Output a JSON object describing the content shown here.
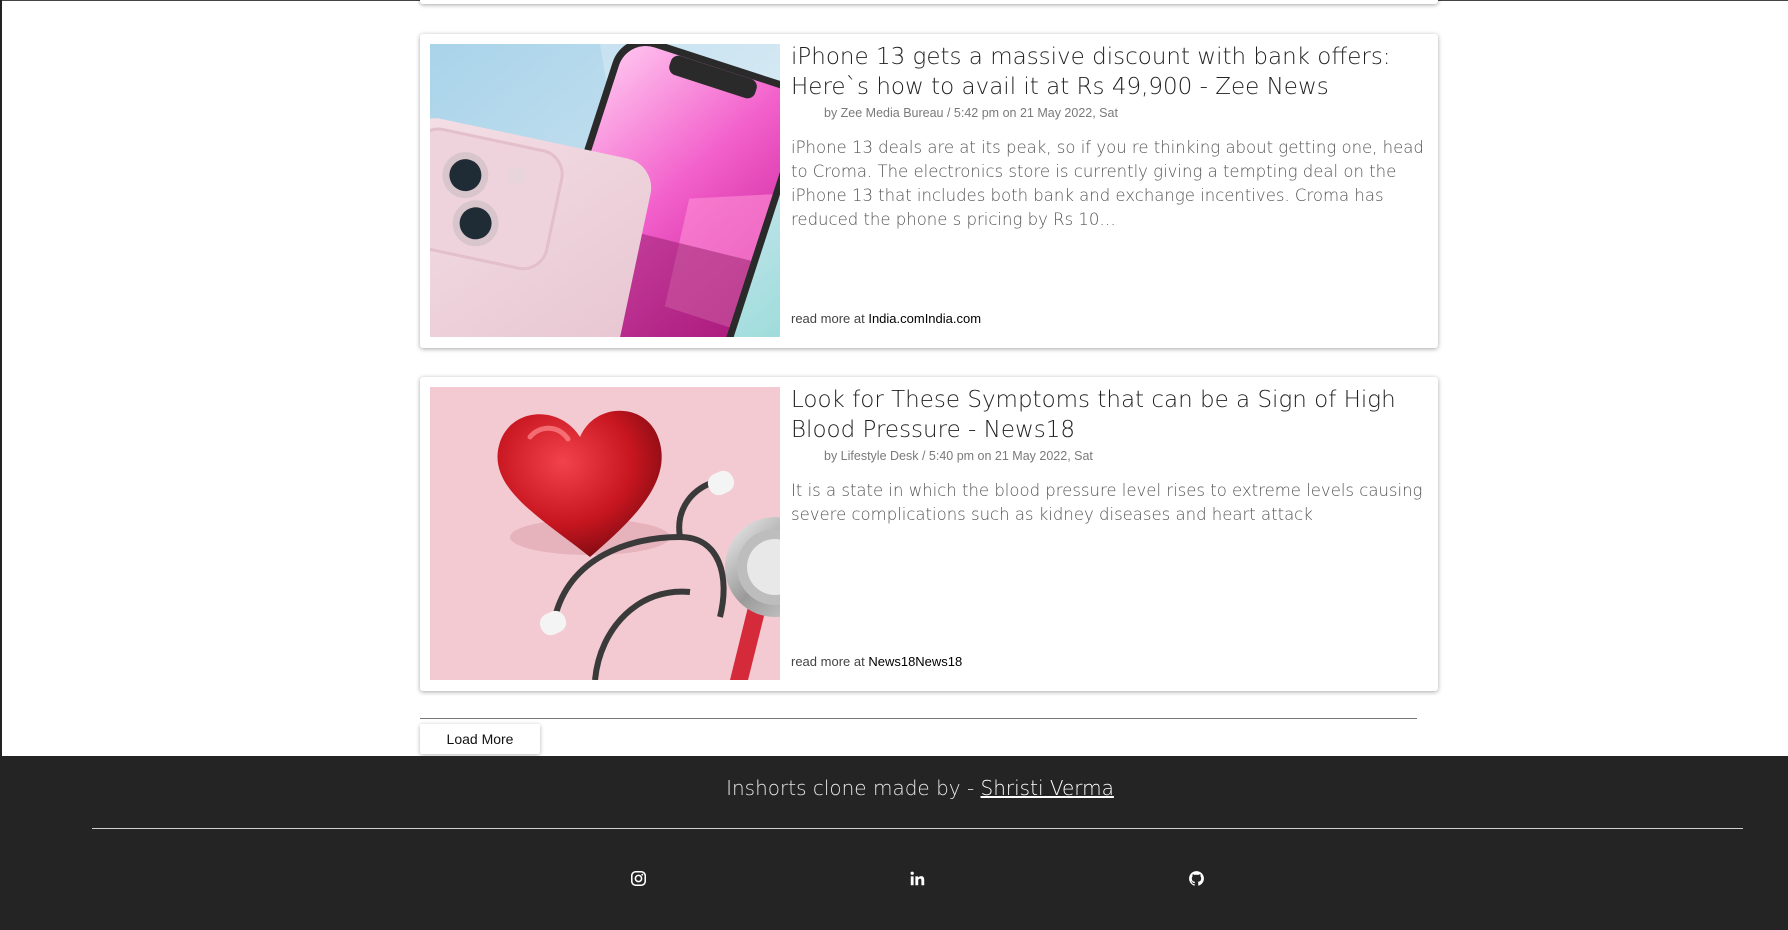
{
  "articles": [
    {
      "title": "iPhone 13 gets a massive discount with bank offers: Here`s how to avail it at Rs 49,900 - Zee News",
      "meta": "by Zee Media Bureau / 5:42 pm on 21 May 2022, Sat",
      "description": "iPhone 13 deals are at its peak, so if you re thinking about getting one, head to Croma. The electronics store is currently giving a tempting deal on the iPhone 13 that includes both bank and exchange incentives. Croma has reduced the phone s pricing by Rs 10…",
      "read_more_prefix": "read more at ",
      "source": "India.comIndia.com"
    },
    {
      "title": "Look for These Symptoms that can be a Sign of High Blood Pressure - News18",
      "meta": "by Lifestyle Desk / 5:40 pm on 21 May 2022, Sat",
      "description": "It is a state in which the blood pressure level rises to extreme levels causing severe complications such as kidney diseases and heart attack",
      "read_more_prefix": "read more at ",
      "source": "News18News18"
    }
  ],
  "load_more_label": "Load More",
  "footer": {
    "credit_prefix": "Inshorts clone made by - ",
    "author": "Shristi Verma",
    "social": [
      "instagram-icon",
      "linkedin-icon",
      "github-icon"
    ]
  },
  "colors": {
    "footer_bg": "#242424",
    "title_text": "#222222",
    "meta_text": "#7a7a7a"
  }
}
